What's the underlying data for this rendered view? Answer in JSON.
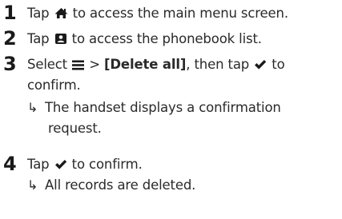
{
  "steps": [
    {
      "number": "1",
      "text_before": "Tap ",
      "icon": "home-icon",
      "text_after": " to access the main menu screen."
    },
    {
      "number": "2",
      "text_before": "Tap ",
      "icon": "phonebook-icon",
      "text_after": " to access the phonebook list."
    },
    {
      "number": "3",
      "text_before": "Select ",
      "icon": "menu-icon",
      "text_mid": " > ",
      "bold_text": "[Delete all]",
      "text_mid2": ", then tap ",
      "icon2": "checkmark-icon",
      "text_after": " to",
      "line2": "confirm.",
      "result_arrow": "↳",
      "result_line1": "The handset displays a confirmation",
      "result_line2": "request."
    },
    {
      "number": "4",
      "text_before": "Tap ",
      "icon": "checkmark-icon",
      "text_after": " to confirm.",
      "result_arrow": "↳",
      "result_line1": "All records are deleted."
    }
  ],
  "colors": {
    "text": "#2a2a2a",
    "number": "#1a1a1a"
  }
}
